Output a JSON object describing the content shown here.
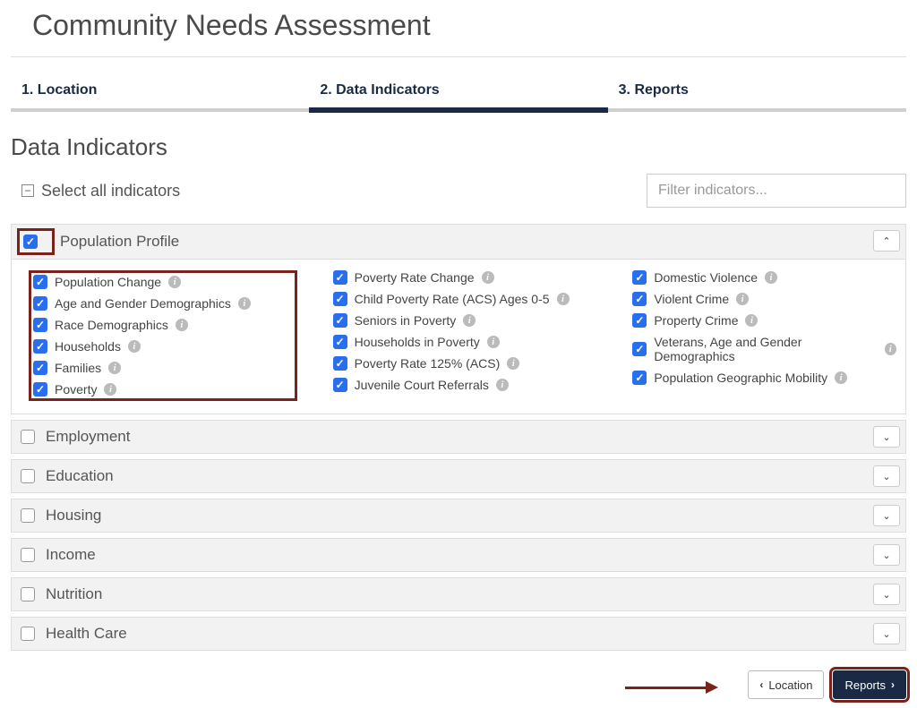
{
  "page_title": "Community Needs Assessment",
  "steps": {
    "s1": "1. Location",
    "s2": "2. Data Indicators",
    "s3": "3. Reports"
  },
  "section_title": "Data Indicators",
  "select_all_label": "Select all indicators",
  "filter_placeholder": "Filter indicators...",
  "categories": {
    "pop_profile": {
      "label": "Population Profile",
      "checked": true,
      "expanded": true,
      "col1": {
        "i0": "Population Change",
        "i1": "Age and Gender Demographics",
        "i2": "Race Demographics",
        "i3": "Households",
        "i4": "Families",
        "i5": "Poverty"
      },
      "col2": {
        "i0": "Poverty Rate Change",
        "i1": "Child Poverty Rate (ACS) Ages 0-5",
        "i2": "Seniors in Poverty",
        "i3": "Households in Poverty",
        "i4": "Poverty Rate 125% (ACS)",
        "i5": "Juvenile Court Referrals"
      },
      "col3": {
        "i0": "Domestic Violence",
        "i1": "Violent Crime",
        "i2": "Property Crime",
        "i3": "Veterans, Age and Gender Demographics",
        "i4": "Population Geographic Mobility"
      }
    },
    "employment": {
      "label": "Employment"
    },
    "education": {
      "label": "Education"
    },
    "housing": {
      "label": "Housing"
    },
    "income": {
      "label": "Income"
    },
    "nutrition": {
      "label": "Nutrition"
    },
    "health": {
      "label": "Health Care"
    }
  },
  "buttons": {
    "back": "Location",
    "next": "Reports"
  }
}
